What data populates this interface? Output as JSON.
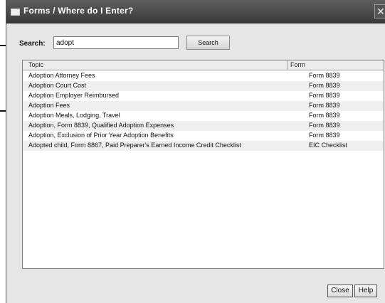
{
  "window": {
    "title": "Forms / Where do I Enter?",
    "close_glyph": "✕"
  },
  "search": {
    "label": "Search:",
    "value": "adopt",
    "button_label": "Search"
  },
  "table": {
    "columns": [
      "Topic",
      "Form"
    ],
    "rows": [
      {
        "topic": "Adoption Attorney Fees",
        "form": "Form 8839"
      },
      {
        "topic": "Adoption Court Cost",
        "form": "Form 8839"
      },
      {
        "topic": "Adoption Employer Reimbursed",
        "form": "Form 8839"
      },
      {
        "topic": "Adoption Fees",
        "form": "Form 8839"
      },
      {
        "topic": "Adoption Meals, Lodging, Travel",
        "form": "Form 8839"
      },
      {
        "topic": "Adoption, Form 8839, Qualified Adoption Expenses",
        "form": "Form 8839"
      },
      {
        "topic": "Adoption, Exclusion of Prior Year Adoption Benefits",
        "form": "Form 8839"
      },
      {
        "topic": "Adopted child, Form 8867, Paid Preparer's Earned Income Credit Checklist",
        "form": "EIC Checklist"
      }
    ]
  },
  "footer": {
    "close_label": "Close",
    "help_label": "Help"
  }
}
